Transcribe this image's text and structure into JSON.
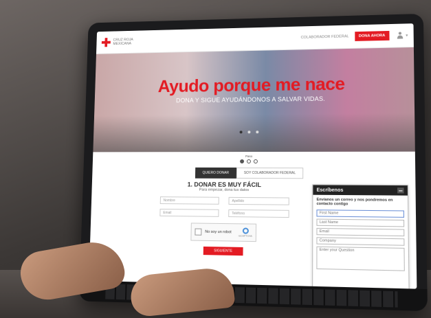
{
  "nav": {
    "logo_text": "CRUZ ROJA MEXICANA",
    "link_collaborator": "COLABORADOR FEDERAL",
    "donate_button": "DONA AHORA",
    "user_icon": "user-icon",
    "accent_color": "#e31b23"
  },
  "hero": {
    "title": "Ayudo porque me nace",
    "subtitle": "DONA Y SIGUE AYUDÁNDONOS A SALVAR VIDAS.",
    "slides_total": 3,
    "active_slide": 1
  },
  "steps": {
    "label": "Paso"
  },
  "tabs": [
    {
      "label": "QUIERO DONAR",
      "active": true
    },
    {
      "label": "SOY COLABORADOR FEDERAL",
      "active": false
    }
  ],
  "form": {
    "title": "1. DONAR ES MUY FÁCIL",
    "subtitle": "Para empezar, dona tus datos",
    "fields": {
      "name": "Nombre",
      "lastname": "Apellido",
      "email": "Email",
      "phone": "Teléfono"
    },
    "captcha_label": "No soy un robot",
    "captcha_brand": "reCAPTCHA",
    "submit_label": "SIGUIENTE"
  },
  "chat": {
    "title": "Escríbenos",
    "intro": "Envíanos un correo y nos pondremos en contacto contigo",
    "fields": {
      "first_name": "First Name",
      "last_name": "Last Name",
      "email": "Email",
      "company": "Company",
      "question": "Enter your Question"
    }
  }
}
